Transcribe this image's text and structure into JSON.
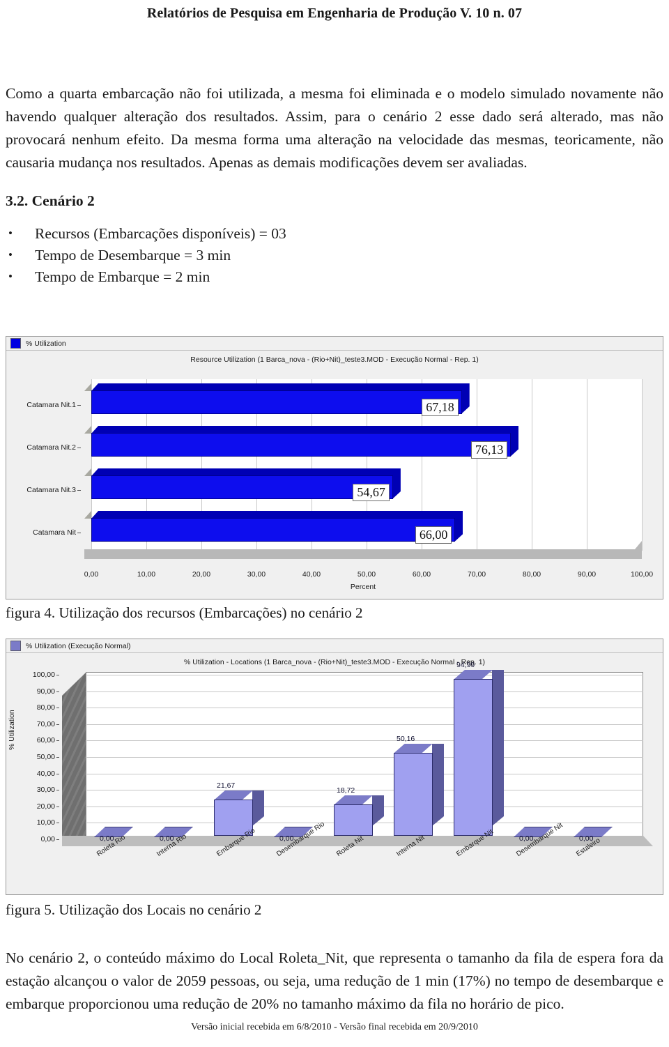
{
  "running_head": "Relatórios de Pesquisa em Engenharia de Produção V. 10 n. 07",
  "paragraphs": {
    "intro": "Como a quarta embarcação não foi utilizada, a mesma foi eliminada e o modelo simulado novamente não havendo qualquer alteração dos resultados. Assim, para o cenário 2 esse dado será alterado, mas não provocará nenhum efeito. Da mesma forma uma alteração na velocidade das mesmas, teoricamente, não causaria mudança nos resultados. Apenas as demais modificações devem ser avaliadas.",
    "closing": "No cenário 2, o conteúdo máximo do Local Roleta_Nit, que representa o tamanho da fila de espera fora da estação alcançou o valor de 2059 pessoas, ou seja, uma redução de 1 min (17%) no tempo de desembarque e embarque proporcionou uma redução de 20% no tamanho máximo da fila no horário de pico."
  },
  "section": {
    "heading": "3.2. Cenário 2",
    "bullets": [
      "Recursos (Embarcações disponíveis) = 03",
      "Tempo de Desembarque = 3 min",
      "Tempo de Embarque = 2 min"
    ]
  },
  "captions": {
    "figure4": "figura 4. Utilização dos recursos (Embarcações) no cenário 2",
    "figure5": "figura 5. Utilização dos Locais no cenário 2"
  },
  "footer": "Versão inicial recebida em 6/8/2010 - Versão final recebida em 20/9/2010",
  "colors": {
    "fig4_bar_front": "#0d0dee",
    "fig4_bar_shade": "#0000b4",
    "fig5_bar_front": "#a0a0f0",
    "fig5_bar_top": "#7b7bc8",
    "fig5_bar_side": "#5a5a9c"
  },
  "chart_data": [
    {
      "type": "bar",
      "orientation": "horizontal",
      "id": "figure4",
      "legend": "% Utilization",
      "legend_position": "top-left",
      "title": "Resource Utilization (1 Barca_nova - (Rio+Nit)_teste3.MOD - Execução Normal - Rep. 1)",
      "categories": [
        "Catamara Nit.1",
        "Catamara Nit.2",
        "Catamara Nit.3",
        "Catamara Nit"
      ],
      "values": [
        67.18,
        76.13,
        54.67,
        66.0
      ],
      "value_labels": [
        "67,18",
        "76,13",
        "54,67",
        "66,00"
      ],
      "xlabel": "Percent",
      "ylabel": "",
      "xlim": [
        0,
        100
      ],
      "xticks": [
        0,
        10,
        20,
        30,
        40,
        50,
        60,
        70,
        80,
        90,
        100
      ],
      "xtick_labels": [
        "0,00",
        "10,00",
        "20,00",
        "30,00",
        "40,00",
        "50,00",
        "60,00",
        "70,00",
        "80,00",
        "90,00",
        "100,00"
      ],
      "grid": true
    },
    {
      "type": "bar",
      "orientation": "vertical",
      "id": "figure5",
      "legend": "% Utilization (Execução Normal)",
      "legend_position": "top-left",
      "title": "% Utilization - Locations (1 Barca_nova - (Rio+Nit)_teste3.MOD - Execução Normal - Rep. 1)",
      "categories": [
        "Roleta Rio",
        "Interna Rio",
        "Embarque Rio",
        "Desembarque Rio",
        "Roleta Nit",
        "Interna Nit",
        "Embarque Nit",
        "Desembarque Nit",
        "Estaleiro"
      ],
      "values": [
        0.0,
        0.0,
        21.67,
        0.0,
        18.72,
        50.16,
        94.99,
        0.0,
        0.0
      ],
      "value_labels": [
        "0,00",
        "0,00",
        "21,67",
        "0,00",
        "18,72",
        "50,16",
        "94,99",
        "0,00",
        "0,00"
      ],
      "xlabel": "",
      "ylabel": "% Utilization",
      "ylim": [
        0,
        100
      ],
      "yticks": [
        0,
        10,
        20,
        30,
        40,
        50,
        60,
        70,
        80,
        90,
        100
      ],
      "ytick_labels": [
        "0,00",
        "10,00",
        "20,00",
        "30,00",
        "40,00",
        "50,00",
        "60,00",
        "70,00",
        "80,00",
        "90,00",
        "100,00"
      ],
      "grid": true
    }
  ]
}
